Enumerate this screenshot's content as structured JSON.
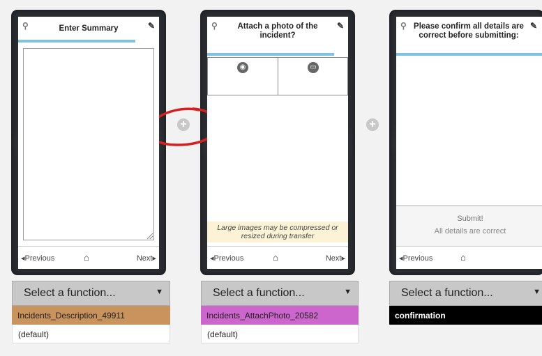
{
  "screens": [
    {
      "title": "Enter Summary",
      "nav": {
        "prev": "◂Previous",
        "home_icon": "home-icon",
        "next": "Next▸"
      }
    },
    {
      "title": "Attach a photo of the incident?",
      "photo_options": {
        "camera_icon": "camera-icon",
        "folder_icon": "folder-icon"
      },
      "notice": "Large images may be compressed or resized during transfer",
      "nav": {
        "prev": "◂Previous",
        "home_icon": "home-icon",
        "next": "Next▸"
      }
    },
    {
      "title": "Please confirm all details are correct before submitting:",
      "submit_label": "Submit!",
      "submit_sub": "All details are correct",
      "nav": {
        "prev": "◂Previous",
        "home_icon": "home-icon"
      }
    }
  ],
  "steps": [
    {
      "select_label": "Select a function...",
      "function_name": "Incidents_Description_49911",
      "function_color": "#c8935c",
      "function_text_color": "#222222",
      "default_label": "(default)"
    },
    {
      "select_label": "Select a function...",
      "function_name": "Incidents_AttachPhoto_20582",
      "function_color": "#cc66cc",
      "function_text_color": "#222222",
      "default_label": "(default)"
    },
    {
      "select_label": "Select a function...",
      "function_name": "confirmation",
      "function_color": "#000000",
      "function_text_color": "#ffffff"
    }
  ],
  "add_step_icon": "plus-icon",
  "colors": {
    "progress": "#7fc3e4",
    "annotation_circle": "#d42020",
    "frame": "#2b2e33"
  }
}
